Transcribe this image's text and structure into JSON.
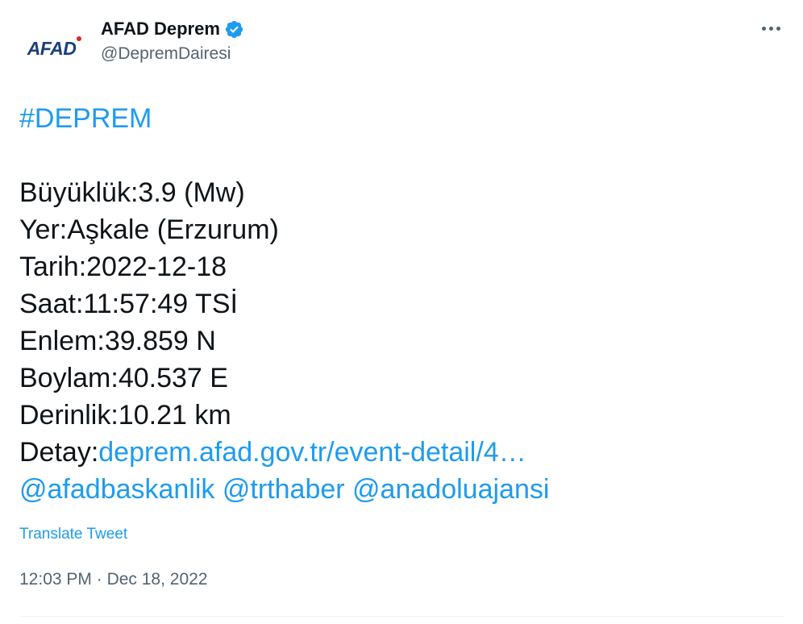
{
  "author": {
    "display_name": "AFAD Deprem",
    "handle": "@DepremDairesi",
    "avatar_text": "AFAD",
    "verified_icon": "verified-badge-icon",
    "verified_color": "#1d9bf0"
  },
  "more_icon": "more-options-icon",
  "tweet": {
    "hashtag": "#DEPREM",
    "lines": {
      "magnitude": "Büyüklük:3.9 (Mw)",
      "location": "Yer:Aşkale (Erzurum)",
      "date": "Tarih:2022-12-18",
      "time": "Saat:11:57:49 TSİ",
      "latitude": "Enlem:39.859 N",
      "longitude": "Boylam:40.537 E",
      "depth": "Derinlik:10.21 km",
      "detail_label": "Detay:",
      "detail_link": "deprem.afad.gov.tr/event-detail/4…"
    },
    "mentions": [
      "@afadbaskanlik",
      "@trthaber",
      "@anadoluajansi"
    ]
  },
  "translate_label": "Translate Tweet",
  "meta": {
    "time": "12:03 PM",
    "separator": " · ",
    "date": "Dec 18, 2022"
  },
  "colors": {
    "link": "#1d9bf0",
    "text": "#0f1419",
    "secondary": "#536471",
    "avatar_brand": "#1d3f7a",
    "avatar_dot": "#e0222a"
  }
}
